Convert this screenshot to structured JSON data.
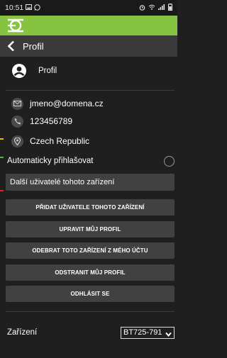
{
  "status_bar": {
    "time": "10:51",
    "left_icons": [
      "gallery-icon",
      "whatsapp-icon"
    ],
    "right_icons": [
      "alarm-icon",
      "wifi-icon",
      "signal-icon",
      "battery-icon"
    ]
  },
  "brand": {
    "logo": "logo-icon",
    "color": "#86c341"
  },
  "nav": {
    "back_icon": "chevron-left-icon",
    "title": "Profil"
  },
  "profile": {
    "icon": "account-circle-icon",
    "label": "Profil"
  },
  "contact": {
    "email": "jmeno@domena.cz",
    "phone": "123456789",
    "country": "Czech Republic"
  },
  "auto_login": {
    "label": "Automaticky přihlašovat",
    "checked": false
  },
  "other_users_button": "Další uživatelé tohoto zařízení",
  "actions": [
    "PŘIDAT UŽIVATELE TOHOTO ZAŘÍZENÍ",
    "UPRAVIT MŮJ PROFIL",
    "ODEBRAT TOTO ZAŘÍZENÍ Z MÉHO ÚČTU",
    "ODSTRANIT MŮJ PROFIL",
    "ODHLÁSIT SE"
  ],
  "device": {
    "label": "Zařízení",
    "selected": "BT725-791"
  },
  "colors": {
    "background": "#1f1f1f",
    "button": "#414141",
    "nav": "#3a3a3a",
    "side_marks": [
      "#e0c000",
      "#4caf50",
      "#e02020"
    ]
  }
}
